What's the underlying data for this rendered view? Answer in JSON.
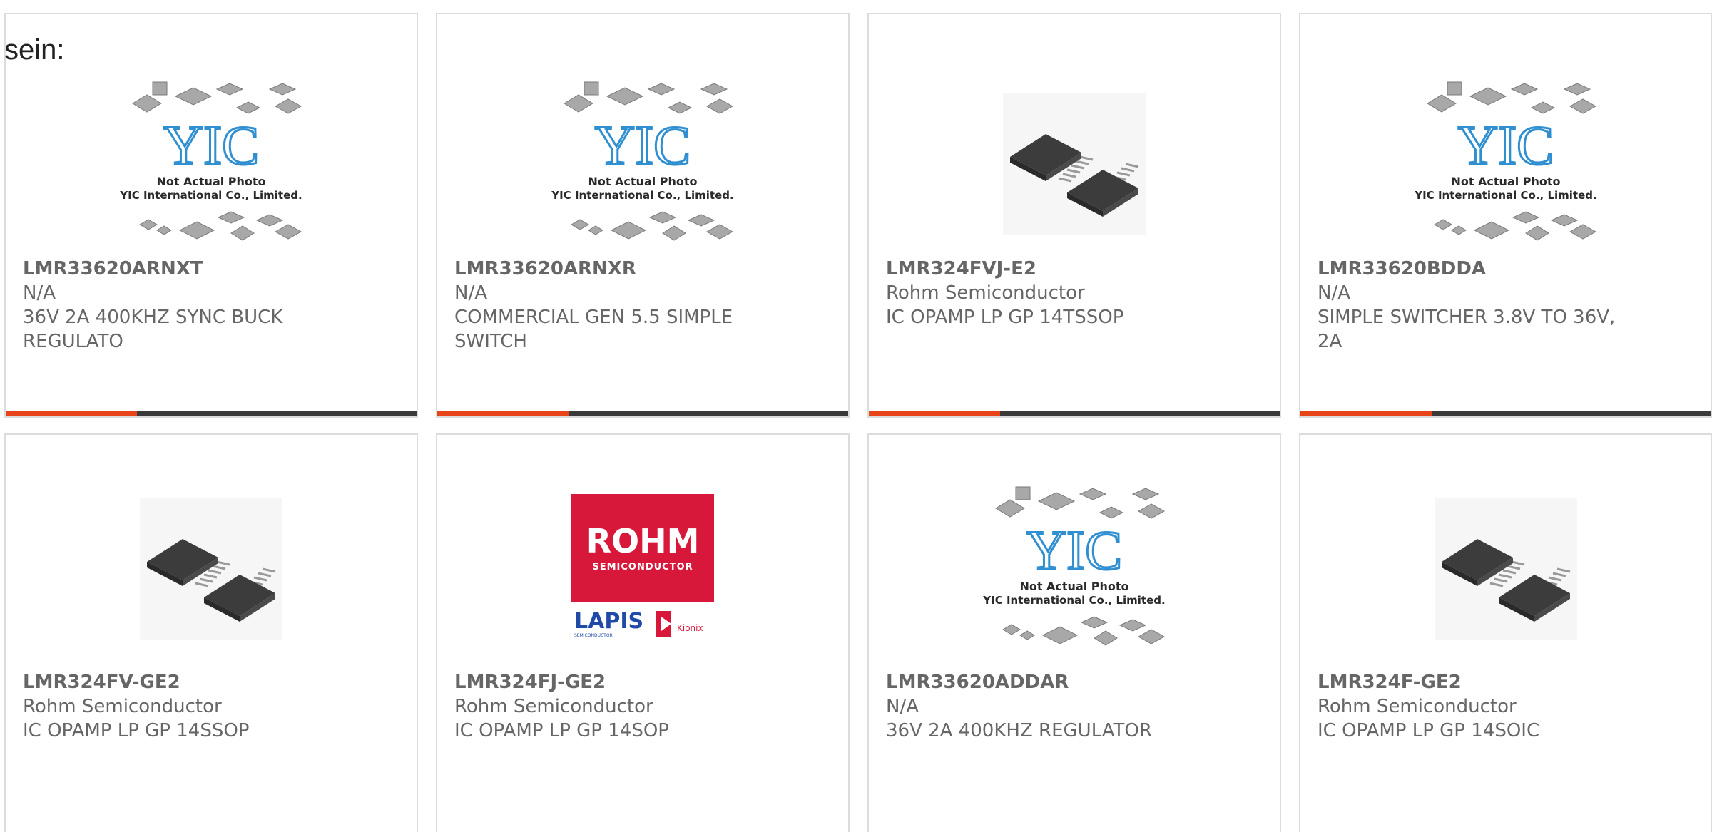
{
  "leadin": "sein:",
  "placeholder_image": {
    "line1": "Not Actual Photo",
    "line2": "YIC International Co., Limited.",
    "logo": "YIC"
  },
  "rohm_logo": {
    "brand": "ROHM",
    "sub": "SEMICONDUCTOR",
    "lapis": "LAPIS",
    "lapis_sub": "SEMICONDUCTOR",
    "kionix": "Kionix"
  },
  "colors": {
    "accent": "#e8441a",
    "bar_dark": "#3a3a3a",
    "text": "#666666",
    "yic_blue": "#2f8fd0",
    "rohm_red": "#d7183b"
  },
  "products": [
    {
      "part": "LMR33620ARNXT",
      "manufacturer": "N/A",
      "description": "36V 2A 400KHZ SYNC BUCK REGULATO",
      "image": "placeholder"
    },
    {
      "part": "LMR33620ARNXR",
      "manufacturer": "N/A",
      "description": "COMMERCIAL GEN 5.5 SIMPLE SWITCH",
      "image": "placeholder"
    },
    {
      "part": "LMR324FVJ-E2",
      "manufacturer": "Rohm Semiconductor",
      "description": "IC OPAMP LP GP 14TSSOP",
      "image": "chip"
    },
    {
      "part": "LMR33620BDDA",
      "manufacturer": "N/A",
      "description": "SIMPLE SWITCHER 3.8V TO 36V, 2A",
      "image": "placeholder"
    },
    {
      "part": "LMR324FV-GE2",
      "manufacturer": "Rohm Semiconductor",
      "description": "IC OPAMP LP GP 14SSOP",
      "image": "chip"
    },
    {
      "part": "LMR324FJ-GE2",
      "manufacturer": "Rohm Semiconductor",
      "description": "IC OPAMP LP GP 14SOP",
      "image": "rohm"
    },
    {
      "part": "LMR33620ADDAR",
      "manufacturer": "N/A",
      "description": "36V 2A 400KHZ REGULATOR",
      "image": "placeholder"
    },
    {
      "part": "LMR324F-GE2",
      "manufacturer": "Rohm Semiconductor",
      "description": "IC OPAMP LP GP 14SOIC",
      "image": "chip"
    }
  ]
}
